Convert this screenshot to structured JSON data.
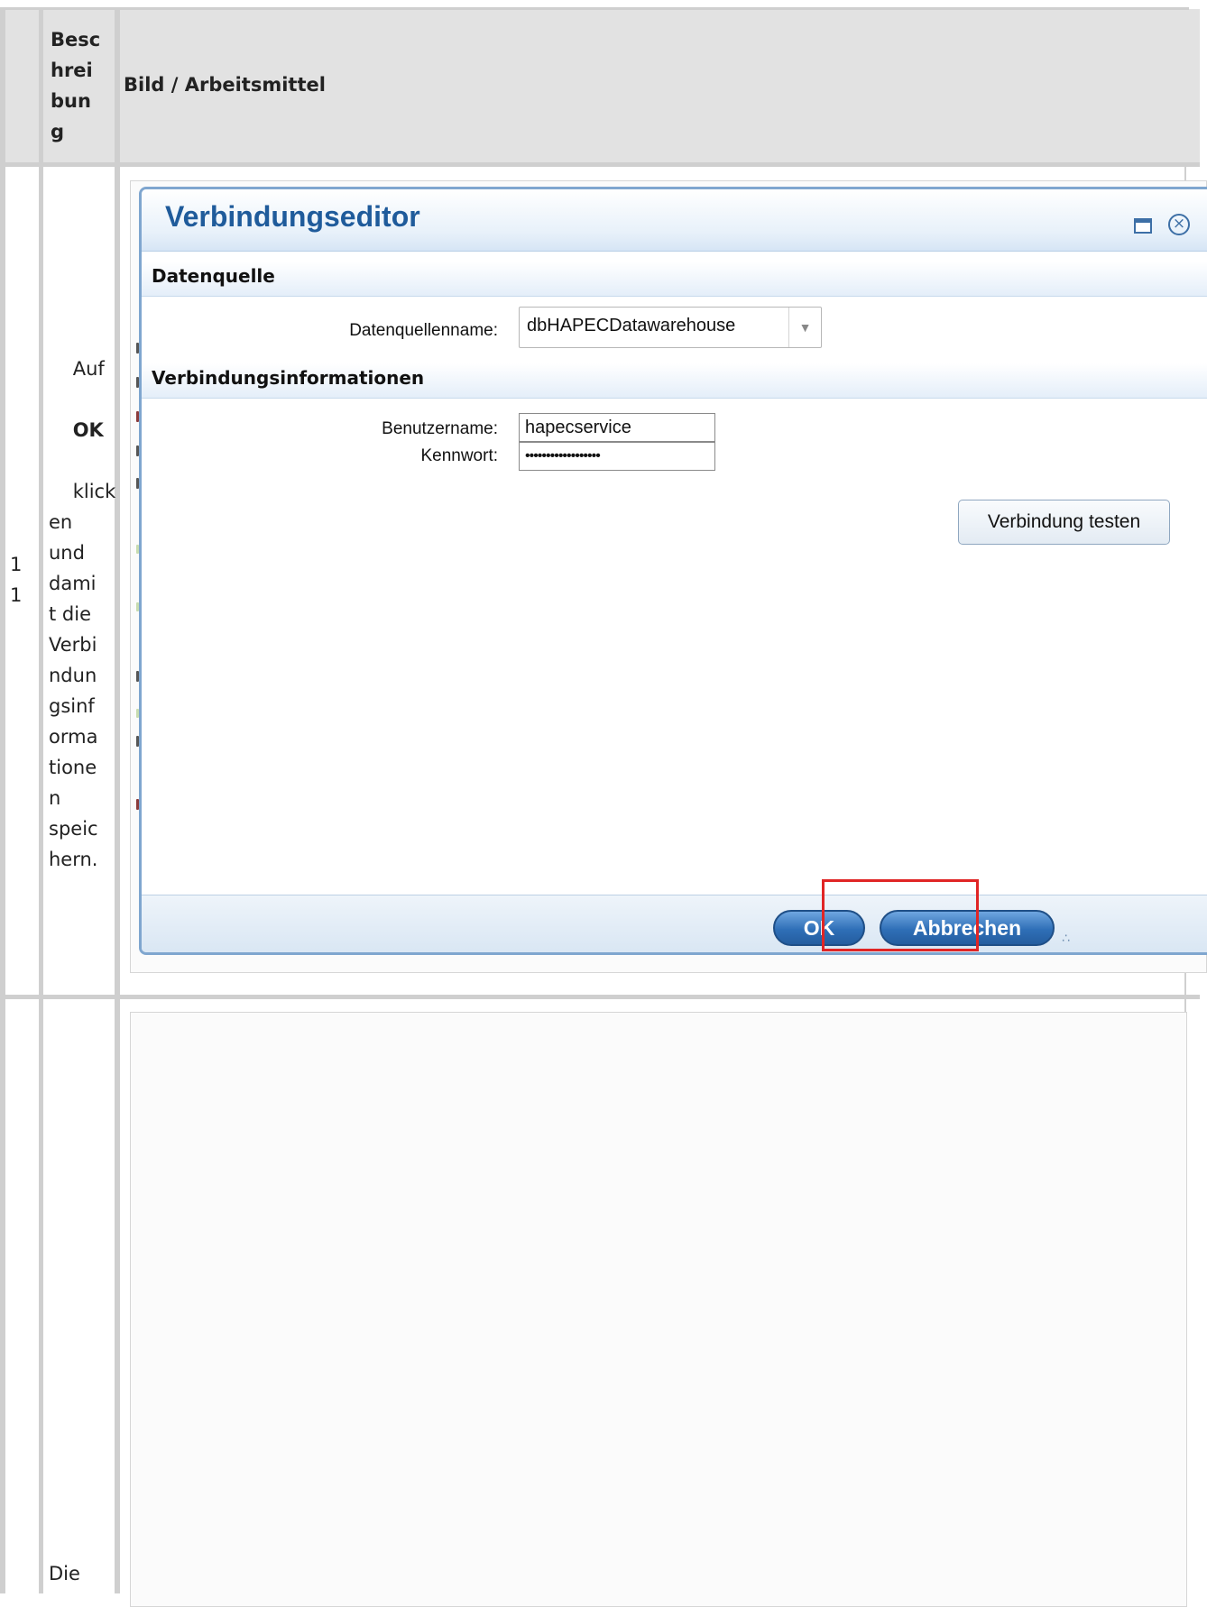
{
  "table": {
    "header_col2": "Besc\nhrei\nbun\ng",
    "header_col3": "Bild / Arbeitsmittel"
  },
  "rows": [
    {
      "number": "1\n1",
      "desc_before": "Auf",
      "desc_bold": "OK",
      "desc_after": "klick\nen\nund\ndami\nt die\nVerbi\nndun\ngsinf\norma\ntione\nn\nspeic\nhern."
    },
    {
      "number": "",
      "desc": "Die"
    }
  ],
  "dialog": {
    "title": "Verbindungseditor",
    "section_datasource": "Datenquelle",
    "datasource_label": "Datenquellenname:",
    "datasource_value": "dbHAPECDatawarehouse",
    "section_connection": "Verbindungsinformationen",
    "username_label": "Benutzername:",
    "username_value": "hapecservice",
    "password_label": "Kennwort:",
    "password_value": "••••••••••••••••••",
    "test_button": "Verbindung testen",
    "ok_button": "OK",
    "cancel_button": "Abbrechen"
  },
  "colors": {
    "title_blue": "#1f5b9b",
    "button_blue": "#2f6fb7",
    "highlight_red": "#e02525",
    "table_header_bg": "#e2e2e2"
  },
  "icons": {
    "maximize": "maximize-icon",
    "close": "close-icon",
    "dropdown": "chevron-down-icon",
    "resize": "resize-grip-icon"
  }
}
